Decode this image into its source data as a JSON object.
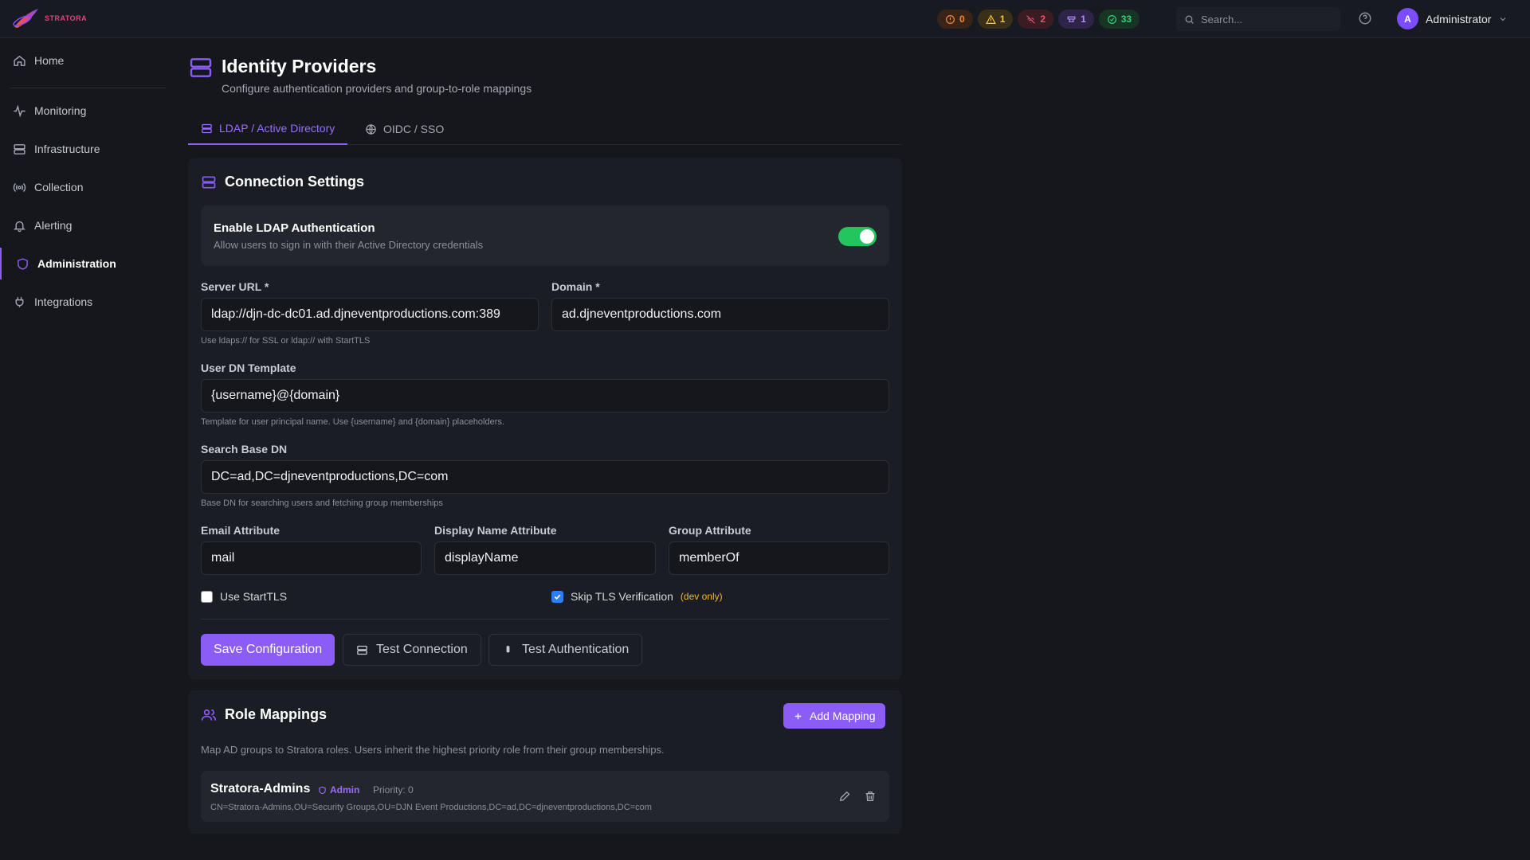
{
  "app": {
    "name": "STRATORA"
  },
  "topbar": {
    "badges": [
      {
        "icon": "alert-circle-icon",
        "count": "0",
        "color": "#f08a3c"
      },
      {
        "icon": "warning-triangle-icon",
        "count": "1",
        "color": "#f5c542"
      },
      {
        "icon": "signal-off-icon",
        "count": "2",
        "color": "#f0506e"
      },
      {
        "icon": "plug-icon",
        "count": "1",
        "color": "#b08cff"
      },
      {
        "icon": "check-circle-icon",
        "count": "33",
        "color": "#34d178"
      }
    ],
    "search_placeholder": "Search...",
    "user_initial": "A",
    "user_name": "Administrator"
  },
  "sidebar": {
    "items": [
      {
        "label": "Home",
        "icon": "home-icon"
      },
      {
        "label": "Monitoring",
        "icon": "activity-icon"
      },
      {
        "label": "Infrastructure",
        "icon": "server-icon"
      },
      {
        "label": "Collection",
        "icon": "radio-icon"
      },
      {
        "label": "Alerting",
        "icon": "bell-icon"
      },
      {
        "label": "Administration",
        "icon": "shield-icon",
        "active": true
      },
      {
        "label": "Integrations",
        "icon": "plug-icon"
      }
    ]
  },
  "page": {
    "title": "Identity Providers",
    "subtitle": "Configure authentication providers and group-to-role mappings"
  },
  "tabs": [
    {
      "label": "LDAP / Active Directory",
      "active": true
    },
    {
      "label": "OIDC / SSO",
      "active": false
    }
  ],
  "connection": {
    "title": "Connection Settings",
    "enable_title": "Enable LDAP Authentication",
    "enable_sub": "Allow users to sign in with their Active Directory credentials",
    "enabled": true,
    "server_url_label": "Server URL *",
    "server_url": "ldap://djn-dc-dc01.ad.djneventproductions.com:389",
    "server_url_hint": "Use ldaps:// for SSL or ldap:// with StartTLS",
    "domain_label": "Domain *",
    "domain": "ad.djneventproductions.com",
    "user_dn_label": "User DN Template",
    "user_dn": "{username}@{domain}",
    "user_dn_hint": "Template for user principal name. Use {username} and {domain} placeholders.",
    "base_dn_label": "Search Base DN",
    "base_dn": "DC=ad,DC=djneventproductions,DC=com",
    "base_dn_hint": "Base DN for searching users and fetching group memberships",
    "email_label": "Email Attribute",
    "email": "mail",
    "display_label": "Display Name Attribute",
    "display": "displayName",
    "group_label": "Group Attribute",
    "group": "memberOf",
    "starttls_label": "Use StartTLS",
    "starttls": false,
    "skip_tls_label": "Skip TLS Verification",
    "skip_tls": true,
    "dev_only": "(dev only)",
    "save_label": "Save Configuration",
    "test_conn_label": "Test Connection",
    "test_auth_label": "Test Authentication"
  },
  "roles": {
    "title": "Role Mappings",
    "add_label": "Add Mapping",
    "description": "Map AD groups to Stratora roles. Users inherit the highest priority role from their group memberships.",
    "mappings": [
      {
        "name": "Stratora-Admins",
        "role": "Admin",
        "priority": "Priority: 0",
        "dn": "CN=Stratora-Admins,OU=Security Groups,OU=DJN Event Productions,DC=ad,DC=djneventproductions,DC=com"
      }
    ]
  }
}
